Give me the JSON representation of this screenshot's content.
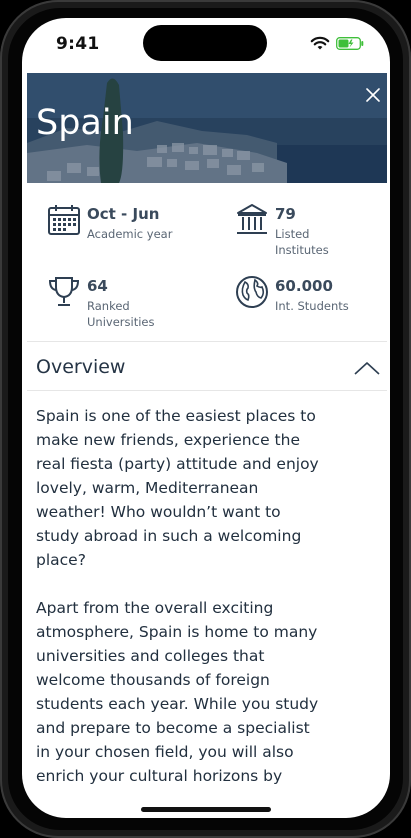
{
  "status_bar": {
    "time": "9:41"
  },
  "hero": {
    "title": "Spain"
  },
  "stats": {
    "academic_year": {
      "value": "Oct - Jun",
      "label": "Academic year"
    },
    "institutes": {
      "value": "79",
      "label": "Listed Institutes"
    },
    "universities": {
      "value": "64",
      "label": "Ranked Universities"
    },
    "students": {
      "value": "60.000",
      "label": "Int. Students"
    }
  },
  "overview": {
    "title": "Overview",
    "paragraphs": [
      "Spain is one of the easiest places to make new friends, experience the real fiesta (party) attitude and enjoy lovely, warm, Mediterranean weather! Who wouldn’t want to study abroad in such a welcoming place?",
      "Apart from the overall exciting atmosphere, Spain is home to many universities and colleges that welcome thousands of foreign students each year. While you study and prepare to become a specialist in your chosen field, you will also enrich your cultural horizons by"
    ]
  },
  "colors": {
    "accent": "#2e3f52",
    "hero": "#2c4660",
    "text": "#22303f"
  },
  "icons": [
    "calendar-icon",
    "institute-icon",
    "trophy-icon",
    "globe-icon",
    "close-icon",
    "chevron-up-icon",
    "wifi-icon",
    "battery-icon"
  ]
}
